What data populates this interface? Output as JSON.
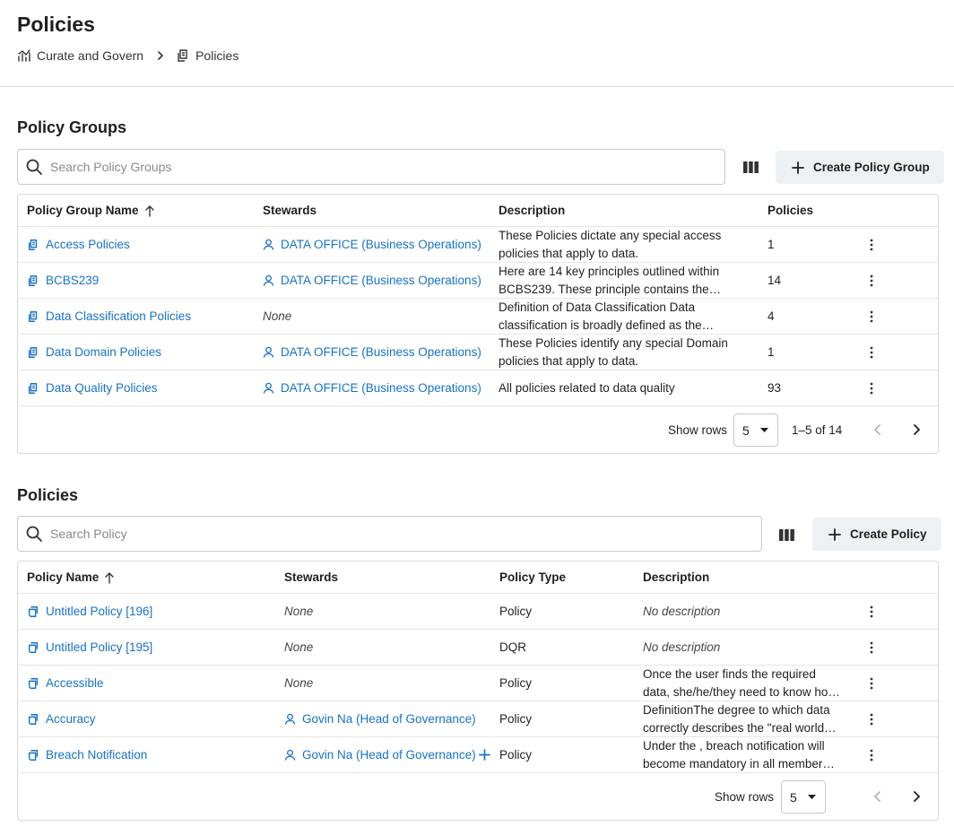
{
  "page": {
    "title": "Policies"
  },
  "breadcrumb": {
    "parent": "Curate and Govern",
    "current": "Policies"
  },
  "groups": {
    "title": "Policy Groups",
    "search_placeholder": "Search Policy Groups",
    "create_label": "Create Policy Group",
    "columns": {
      "name": "Policy Group Name",
      "stewards": "Stewards",
      "description": "Description",
      "policies": "Policies"
    },
    "rows": [
      {
        "name": "Access Policies",
        "steward": "DATA OFFICE (Business Operations)",
        "desc1": "These Policies dictate any special access",
        "desc2": "policies that apply to data.",
        "count": "1"
      },
      {
        "name": "BCBS239",
        "steward": "DATA OFFICE (Business Operations)",
        "desc1": "Here are 14 key principles outlined within",
        "desc2": "BCBS239. These principle contains the…",
        "count": "14"
      },
      {
        "name": "Data Classification Policies",
        "steward": "None",
        "desc1": "Definition of Data Classification Data",
        "desc2": "classification is broadly defined as the…",
        "count": "4"
      },
      {
        "name": "Data Domain Policies",
        "steward": "DATA OFFICE (Business Operations)",
        "desc1": "These Policies identify any special Domain",
        "desc2": "policies that apply to data.",
        "count": "1"
      },
      {
        "name": "Data Quality Policies",
        "steward": "DATA OFFICE (Business Operations)",
        "desc1": "All policies related to data quality",
        "desc2": "",
        "count": "93"
      }
    ],
    "footer": {
      "show_rows": "Show rows",
      "rows_value": "5",
      "range": "1–5 of 14"
    }
  },
  "policies": {
    "title": "Policies",
    "search_placeholder": "Search Policy",
    "create_label": "Create Policy",
    "columns": {
      "name": "Policy Name",
      "stewards": "Stewards",
      "type": "Policy Type",
      "description": "Description"
    },
    "rows": [
      {
        "name": "Untitled Policy [196]",
        "steward": "None",
        "type": "Policy",
        "desc1": "No description",
        "desc2": ""
      },
      {
        "name": "Untitled Policy [195]",
        "steward": "None",
        "type": "DQR",
        "desc1": "No description",
        "desc2": ""
      },
      {
        "name": "Accessible",
        "steward": "None",
        "type": "Policy",
        "desc1": "Once the user finds the required",
        "desc2": "data, she/he/they need to know ho…"
      },
      {
        "name": "Accuracy",
        "steward": "Govin Na (Head of Governance)",
        "type": "Policy",
        "desc1": "DefinitionThe degree to which data",
        "desc2": "correctly describes the \"real world…"
      },
      {
        "name": "Breach Notification",
        "steward": "Govin Na (Head of Governance)",
        "type": "Policy",
        "desc1": "Under the , breach notification will",
        "desc2": "become mandatory in all member…"
      }
    ],
    "footer": {
      "show_rows": "Show rows",
      "rows_value": "5"
    }
  },
  "colors": {
    "link": "#1672c9",
    "border": "#d9d9d9",
    "button_bg": "#eef1f4"
  }
}
